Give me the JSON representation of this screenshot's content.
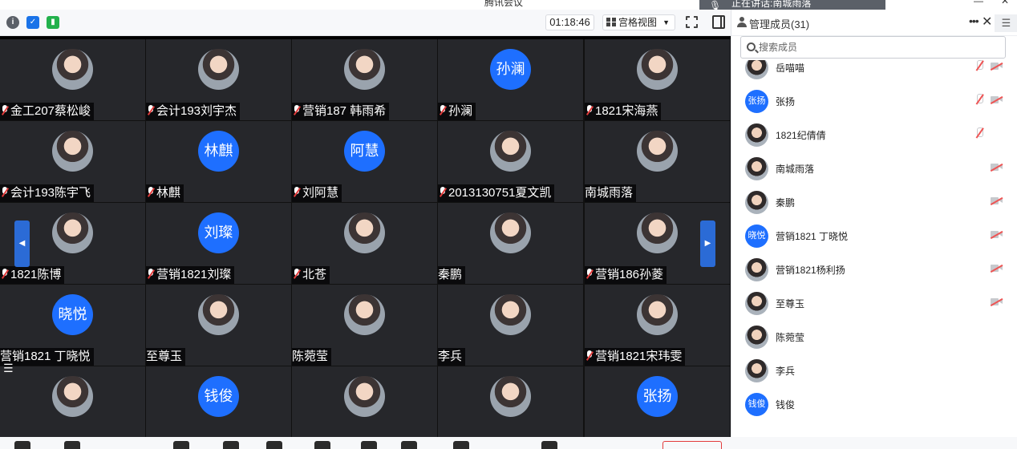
{
  "window": {
    "title": "腾讯会议",
    "banner_text": "正在讲话:南城雨落"
  },
  "toolbar": {
    "elapsed_time": "01:18:46",
    "view_mode": "宫格视图",
    "icons": [
      "info-icon",
      "shield-icon",
      "signal-icon",
      "fullscreen-icon",
      "panel-icon"
    ]
  },
  "grid": {
    "cells": [
      {
        "name": "金工207蔡松峻",
        "avatar": "photo",
        "muted": true
      },
      {
        "name": "会计193刘宇杰",
        "avatar": "photo",
        "muted": true
      },
      {
        "name": "营销187 韩雨希",
        "avatar": "photo",
        "muted": true
      },
      {
        "name": "孙澜",
        "avatar": "孙澜",
        "muted": true
      },
      {
        "name": "1821宋海燕",
        "avatar": "photo",
        "muted": true
      },
      {
        "name": "会计193陈宇飞",
        "avatar": "photo",
        "muted": true
      },
      {
        "name": "林麒",
        "avatar": "林麒",
        "muted": true
      },
      {
        "name": "刘阿慧",
        "avatar": "阿慧",
        "muted": true
      },
      {
        "name": "2013130751夏文凯",
        "avatar": "photo",
        "muted": true
      },
      {
        "name": "南城雨落",
        "avatar": "photo",
        "muted": false
      },
      {
        "name": "1821陈博",
        "avatar": "photo",
        "muted": true
      },
      {
        "name": "营销1821刘璨",
        "avatar": "刘璨",
        "muted": true
      },
      {
        "name": "北苍",
        "avatar": "photo",
        "muted": true
      },
      {
        "name": "秦鹏",
        "avatar": "photo",
        "muted": false
      },
      {
        "name": "营销186孙菱",
        "avatar": "photo",
        "muted": true
      },
      {
        "name": "营销1821 丁晓悦",
        "avatar": "晓悦",
        "muted": false
      },
      {
        "name": "至尊玉",
        "avatar": "photo",
        "muted": false
      },
      {
        "name": "陈菀莹",
        "avatar": "photo",
        "muted": false
      },
      {
        "name": "李兵",
        "avatar": "photo",
        "muted": false
      },
      {
        "name": "营销1821宋玮雯",
        "avatar": "photo",
        "muted": true
      },
      {
        "name": "",
        "avatar": "photo",
        "muted": true
      },
      {
        "name": "",
        "avatar": "钱俊",
        "muted": false
      },
      {
        "name": "",
        "avatar": "photo",
        "muted": true
      },
      {
        "name": "",
        "avatar": "photo",
        "muted": true
      },
      {
        "name": "",
        "avatar": "张扬",
        "muted": true
      }
    ]
  },
  "panel": {
    "title": "管理成员(31)",
    "search_placeholder": "搜索成员",
    "members": [
      {
        "name": "岳喵喵",
        "avatar": "photo",
        "mic_off": true,
        "cam_off": true
      },
      {
        "name": "张扬",
        "avatar": "张扬",
        "mic_off": true,
        "cam_off": true
      },
      {
        "name": "1821纪倩倩",
        "avatar": "photo",
        "mic_off": true,
        "cam_off": false
      },
      {
        "name": "南城雨落",
        "avatar": "photo",
        "mic_off": false,
        "cam_off": true
      },
      {
        "name": "秦鹏",
        "avatar": "photo",
        "mic_off": false,
        "cam_off": true
      },
      {
        "name": "营销1821 丁晓悦",
        "avatar": "晓悦",
        "mic_off": false,
        "cam_off": true
      },
      {
        "name": "营销1821杨利扬",
        "avatar": "photo",
        "mic_off": false,
        "cam_off": true
      },
      {
        "name": "至尊玉",
        "avatar": "photo",
        "mic_off": false,
        "cam_off": true
      },
      {
        "name": "陈菀莹",
        "avatar": "photo",
        "mic_off": false,
        "cam_off": false
      },
      {
        "name": "李兵",
        "avatar": "photo",
        "mic_off": false,
        "cam_off": false
      },
      {
        "name": "钱俊",
        "avatar": "钱俊",
        "mic_off": false,
        "cam_off": false
      }
    ]
  },
  "colors": {
    "accent": "#1e6fff",
    "tile_bg": "#26272b",
    "muted_red": "#e23b3b"
  }
}
